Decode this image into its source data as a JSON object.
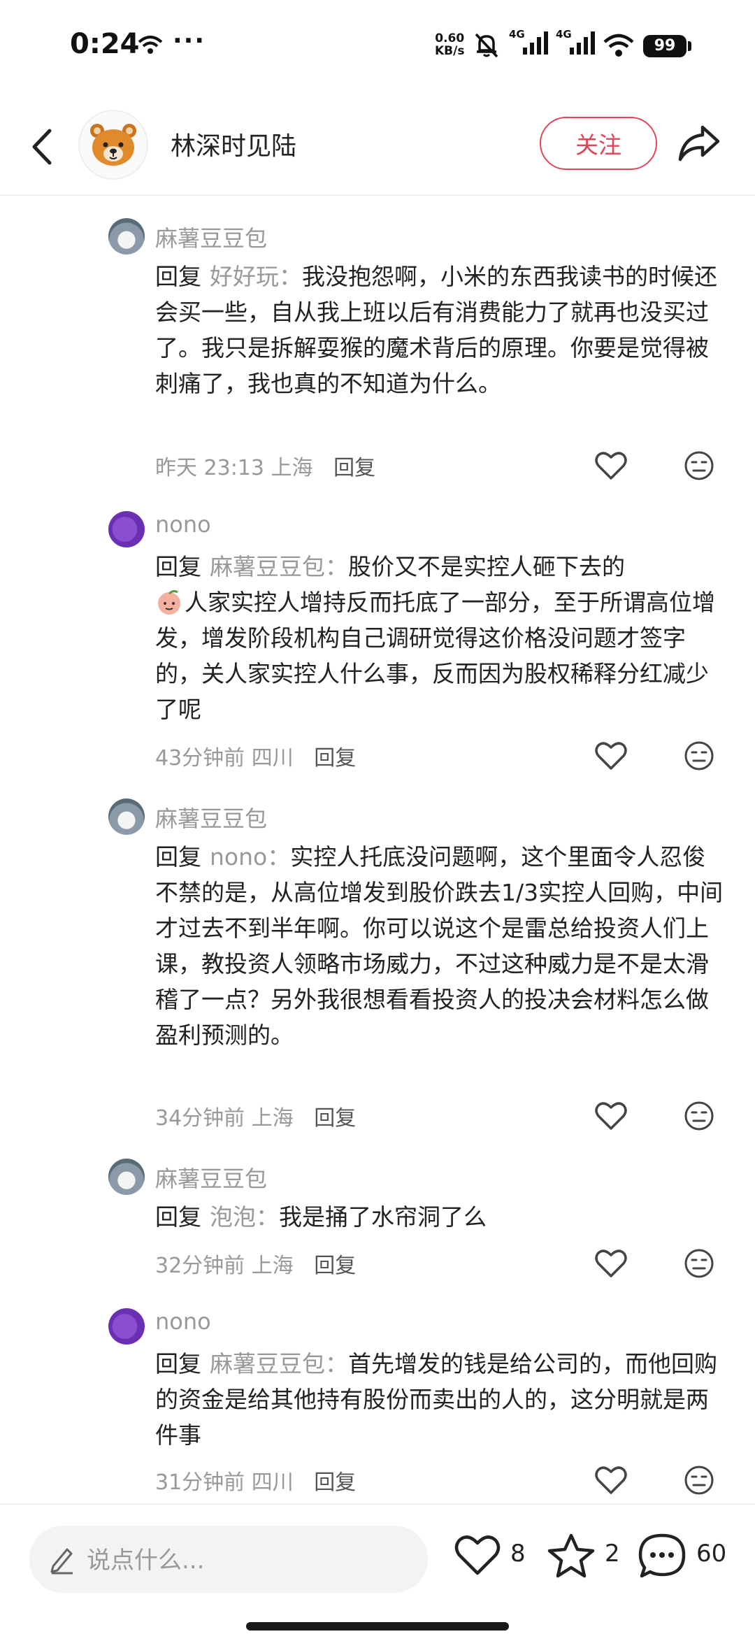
{
  "status_bar": {
    "time": "0:24",
    "dots": "···",
    "net_rate_top": "0.60",
    "net_rate_bottom": "KB/s",
    "sig1_label": "4G",
    "sig2_label": "4G",
    "battery": "99"
  },
  "header": {
    "author_name": "林深时见陆",
    "follow_label": "关注"
  },
  "comments": [
    {
      "user": "麻薯豆豆包",
      "avatar": "potato",
      "reply_word": "回复",
      "reply_to": "好好玩：",
      "text": "我没抱怨啊，小米的东西我读书的时候还会买一些，自从我上班以后有消费能力了就再也没买过了。我只是拆解耍猴的魔术背后的原理。你要是觉得被刺痛了，我也真的不知道为什么。",
      "time": "昨天 23:13",
      "location": "上海",
      "reply_label": "回复"
    },
    {
      "user": "nono",
      "avatar": "nono",
      "reply_word": "回复",
      "reply_to": "麻薯豆豆包：",
      "text": "股价又不是实控人砸下去的",
      "text_after_emoji": "人家实控人增持反而托底了一部分，至于所谓高位增发，增发阶段机构自己调研觉得这价格没问题才签字的，关人家实控人什么事，反而因为股权稀释分红减少了呢",
      "time": "43分钟前",
      "location": "四川",
      "reply_label": "回复"
    },
    {
      "user": "麻薯豆豆包",
      "avatar": "potato",
      "reply_word": "回复",
      "reply_to": "nono：",
      "text": "实控人托底没问题啊，这个里面令人忍俊不禁的是，从高位增发到股价跌去1/3实控人回购，中间才过去不到半年啊。你可以说这个是雷总给投资人们上课，教投资人领略市场威力，不过这种威力是不是太滑稽了一点？另外我很想看看投资人的投决会材料怎么做盈利预测的。",
      "time": "34分钟前",
      "location": "上海",
      "reply_label": "回复"
    },
    {
      "user": "麻薯豆豆包",
      "avatar": "potato",
      "reply_word": "回复",
      "reply_to": "泡泡：",
      "text": "我是捅了水帘洞了么",
      "time": "32分钟前",
      "location": "上海",
      "reply_label": "回复"
    },
    {
      "user": "nono",
      "avatar": "nono",
      "reply_word": "回复",
      "reply_to": "麻薯豆豆包：",
      "text": "首先增发的钱是给公司的，而他回购的资金是给其他持有股份而卖出的人的，这分明就是两件事",
      "time": "31分钟前",
      "location": "四川",
      "reply_label": "回复"
    }
  ],
  "bottom_bar": {
    "input_placeholder": "说点什么...",
    "likes": "8",
    "favorites": "2",
    "comments": "60"
  },
  "colors": {
    "accent": "#e0455a",
    "muted_text": "#999999",
    "body_text": "#222222"
  },
  "icons": [
    "back-arrow-icon",
    "bear-avatar-icon",
    "share-icon",
    "heart-icon",
    "meh-face-icon",
    "pencil-icon",
    "star-icon",
    "chat-bubble-icon",
    "peach-emoji-icon"
  ]
}
